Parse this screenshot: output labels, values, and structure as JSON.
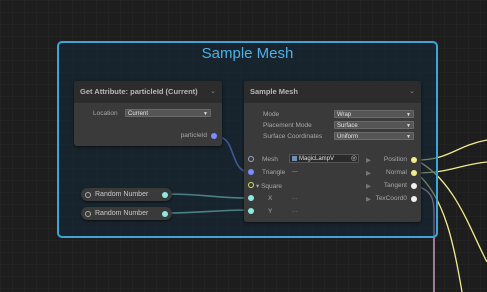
{
  "context": {
    "title": "Sample Mesh"
  },
  "get_attribute": {
    "title": "Get Attribute: particleId (Current)",
    "location_label": "Location",
    "location_value": "Current",
    "output_label": "particleId"
  },
  "sample_mesh": {
    "title": "Sample Mesh",
    "mode_label": "Mode",
    "mode_value": "Wrap",
    "placement_label": "Placement Mode",
    "placement_value": "Surface",
    "coords_label": "Surface Coordinates",
    "coords_value": "Uniform",
    "inputs": {
      "mesh": "Mesh",
      "mesh_value": "MagicLampV",
      "triangle": "Triangle",
      "triangle_value": "—",
      "square": "Square",
      "x": "X",
      "y": "Y",
      "x_value": "...",
      "y_value": "..."
    },
    "outputs": [
      "Position",
      "Normal",
      "Tangent",
      "TexCoord0"
    ]
  },
  "random_nodes": [
    {
      "label": "Random Number"
    },
    {
      "label": "Random Number"
    }
  ],
  "colors": {
    "context_border": "#3fa4d8",
    "wire_blue": "#7b8cff",
    "wire_cyan": "#8ee8e0",
    "wire_yellow": "#f2ec8c",
    "wire_pink": "#e6a8e0"
  }
}
